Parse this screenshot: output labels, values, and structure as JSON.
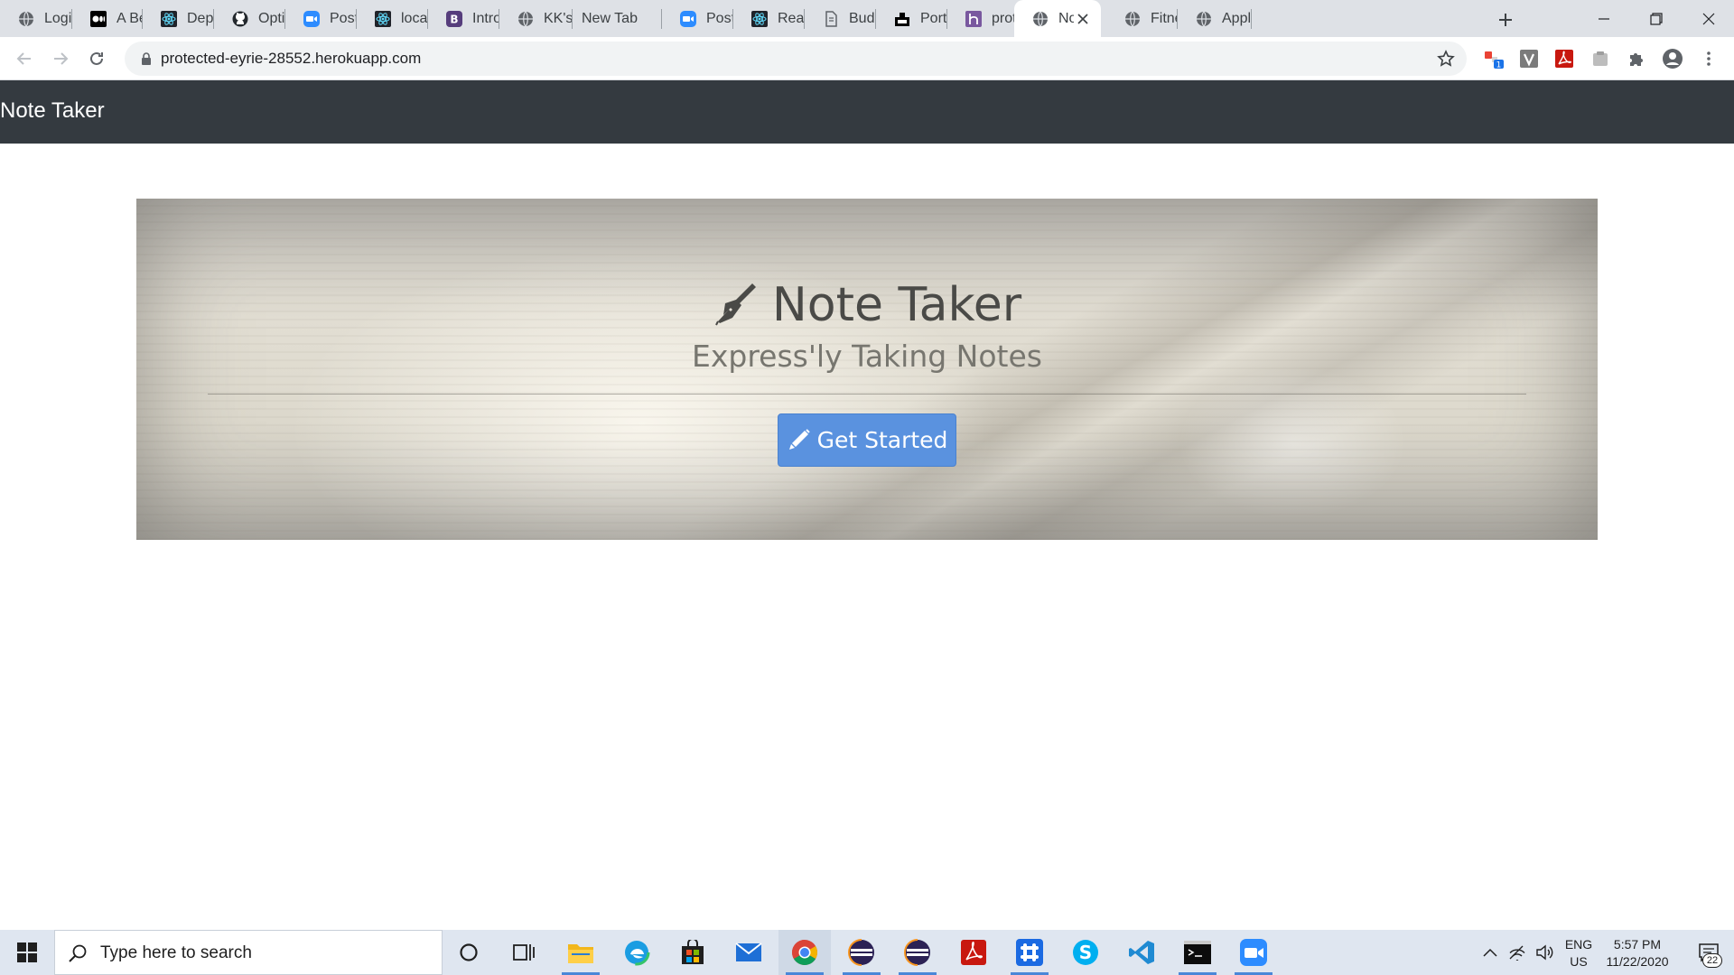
{
  "browser": {
    "tabs": [
      {
        "title": "Login t",
        "favicon": "globe-icon"
      },
      {
        "title": "A Begi",
        "favicon": "medium-icon"
      },
      {
        "title": "Deploy",
        "favicon": "react-icon"
      },
      {
        "title": "Option",
        "favicon": "github-icon"
      },
      {
        "title": "Post At",
        "favicon": "zoom-icon"
      },
      {
        "title": "localho",
        "favicon": "react-icon"
      },
      {
        "title": "Introdu",
        "favicon": "bootstrap-icon"
      },
      {
        "title": "KK's St",
        "favicon": "globe-icon"
      },
      {
        "title": "New Tab",
        "favicon": ""
      },
      {
        "title": "Post At",
        "favicon": "zoom-icon"
      },
      {
        "title": "React",
        "favicon": "react-icon"
      },
      {
        "title": "Budget",
        "favicon": "budget-icon"
      },
      {
        "title": "Portfol",
        "favicon": "portfolio-icon"
      },
      {
        "title": "protec",
        "favicon": "heroku-icon"
      },
      {
        "title": "No",
        "favicon": "globe-icon",
        "active": true
      },
      {
        "title": "Fitness",
        "favicon": "globe-icon"
      },
      {
        "title": "Applic",
        "favicon": "globe-icon"
      }
    ],
    "url": "protected-eyrie-28552.herokuapp.com",
    "extension_badge": "1",
    "colors": {
      "tabstrip": "#dee1e6",
      "omnibox": "#f1f3f4"
    }
  },
  "page": {
    "navbar": {
      "brand": "Note Taker",
      "background": "#343a40"
    },
    "hero": {
      "title": "Note Taker",
      "subtitle": "Express'ly Taking Notes",
      "button_label": "Get Started",
      "button_color": "#5a92df"
    }
  },
  "taskbar": {
    "search_placeholder": "Type here to search",
    "apps": [
      "cortana",
      "task-view",
      "file-explorer",
      "edge",
      "store",
      "mail",
      "chrome",
      "eclipse",
      "eclipse",
      "acrobat",
      "slack",
      "skype",
      "vscode",
      "terminal",
      "zoom"
    ],
    "lang_line1": "ENG",
    "lang_line2": "US",
    "time": "5:57 PM",
    "date": "11/22/2020",
    "notification_count": "22"
  }
}
